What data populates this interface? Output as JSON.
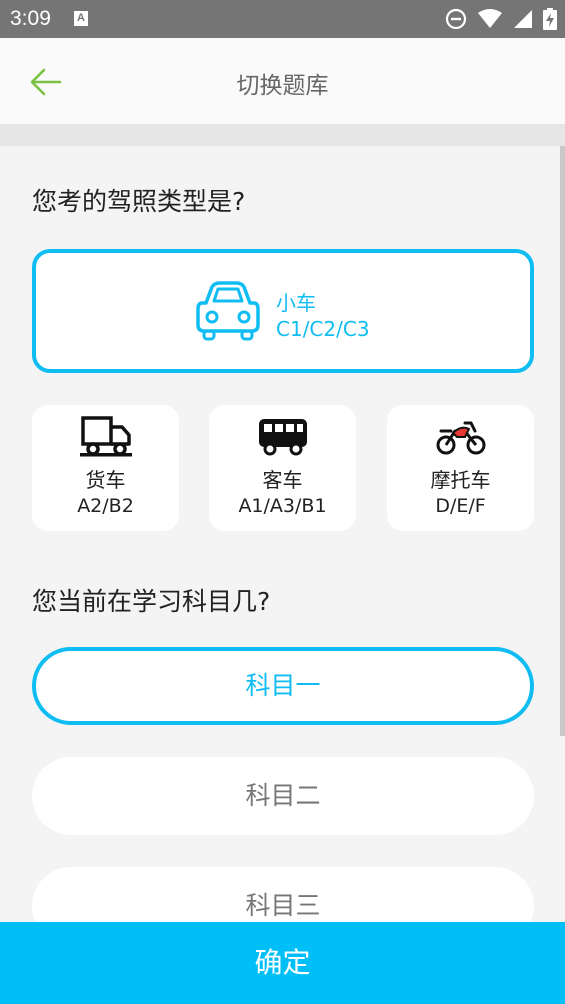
{
  "status_bar": {
    "time": "3:09",
    "notification_letter": "A"
  },
  "app_bar": {
    "title": "切换题库"
  },
  "license_section": {
    "question": "您考的驾照类型是?",
    "selected_option": {
      "name": "小车",
      "codes": "C1/C2/C3",
      "icon": "car-icon"
    },
    "options": [
      {
        "name": "货车",
        "codes": "A2/B2",
        "icon": "truck-icon"
      },
      {
        "name": "客车",
        "codes": "A1/A3/B1",
        "icon": "bus-icon"
      },
      {
        "name": "摩托车",
        "codes": "D/E/F",
        "icon": "motorcycle-icon"
      }
    ]
  },
  "subject_section": {
    "question": "您当前在学习科目几?",
    "subjects": [
      "科目一",
      "科目二",
      "科目三"
    ],
    "selected_index": 0
  },
  "confirm_label": "确定",
  "colors": {
    "accent": "#10bdf2",
    "back_arrow": "#7cc242",
    "confirm_bg": "#00bff8"
  }
}
